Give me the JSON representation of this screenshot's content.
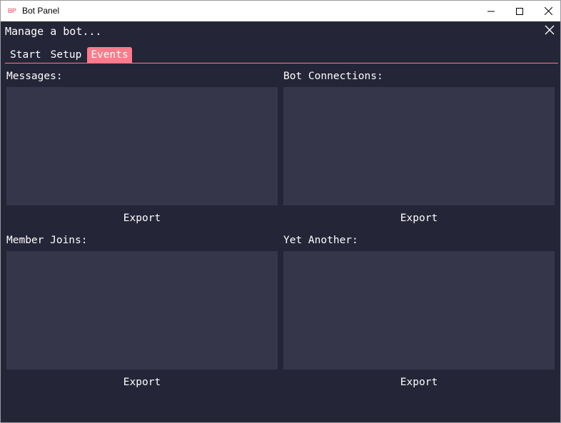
{
  "window": {
    "app_icon_text": "BP",
    "title": "Bot Panel",
    "controls": [
      "minimize",
      "maximize",
      "close"
    ]
  },
  "panel": {
    "title": "Manage a bot...",
    "close_icon": "close-icon"
  },
  "tabs": [
    {
      "label": "Start",
      "active": false
    },
    {
      "label": "Setup",
      "active": false
    },
    {
      "label": "Events",
      "active": true
    }
  ],
  "sections": [
    {
      "label": "Messages:",
      "button": "Export"
    },
    {
      "label": "Bot Connections:",
      "button": "Export"
    },
    {
      "label": "Member Joins:",
      "button": "Export"
    },
    {
      "label": "Yet Another:",
      "button": "Export"
    }
  ],
  "colors": {
    "accent": "#ff7a8a",
    "background": "#252538",
    "box": "#353649",
    "text": "#ffffff"
  }
}
